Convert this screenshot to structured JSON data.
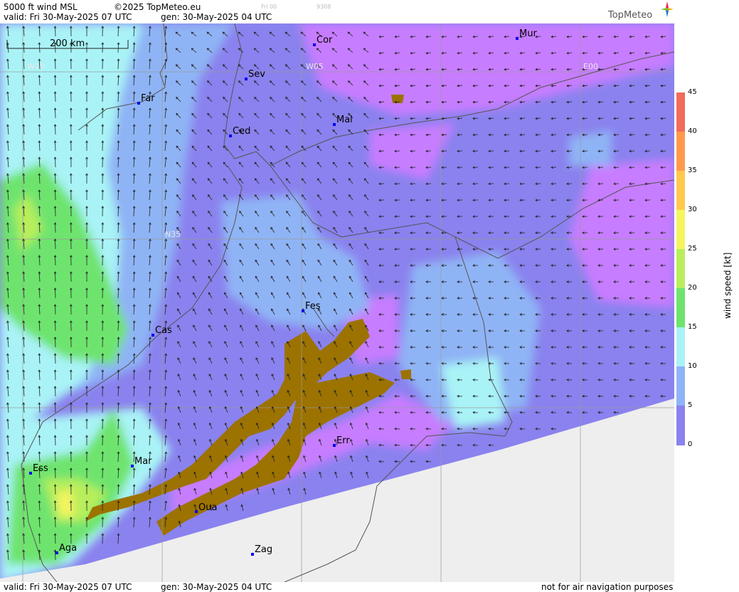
{
  "header": {
    "product": "5000 ft wind MSL",
    "copyright": "©2025 TopMeteo.eu",
    "valid": "valid:  Fri  30-May-2025  07 UTC",
    "gen": "gen: 30-May-2025 04 UTC",
    "small_1": "Fri 00",
    "small_2": "9308"
  },
  "logo": "TopMeteo",
  "scale_bar": "200 km",
  "grid_labels": {
    "w10": "W10",
    "w05": "W05",
    "e00": "E00",
    "n35": "N35"
  },
  "cities": [
    "Cor",
    "Mur",
    "Sev",
    "Far",
    "Mal",
    "Ced",
    "Fes",
    "Cas",
    "Err",
    "Mar",
    "Ess",
    "Oua",
    "Aga",
    "Zag"
  ],
  "legend": {
    "title": "wind speed [kt]",
    "ticks": [
      "45",
      "40",
      "35",
      "30",
      "25",
      "20",
      "15",
      "10",
      "5",
      "0"
    ],
    "colors": {
      "0": "#c77dff",
      "5": "#8a82ee",
      "10": "#8fb4f5",
      "15": "#a9f3f6",
      "20": "#6ee46e",
      "25": "#b8ee5c",
      "30": "#f5f560",
      "35": "#ffc94d",
      "40": "#ff9a4d",
      "45": "#f26b5b"
    }
  },
  "terrain_color": "#9c7200",
  "nodata_color": "#eeeeee",
  "footer": {
    "valid": "valid:  Fri  30-May-2025  07 UTC",
    "gen": "gen: 30-May-2025 04 UTC",
    "notice": "not for air navigation purposes"
  }
}
